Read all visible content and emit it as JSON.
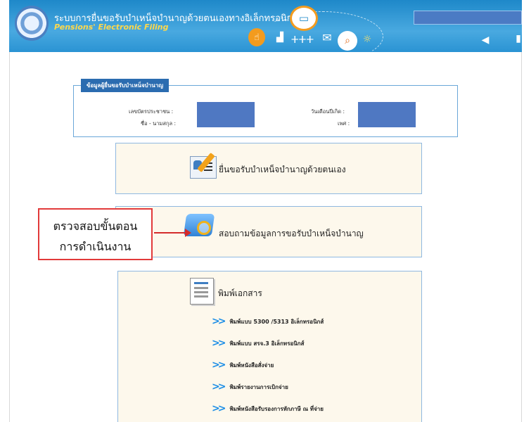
{
  "header": {
    "title": "ระบบการยื่นขอรับบำเหน็จบำนาญด้วยตนเองทางอิเล็กทรอนิกส์",
    "subtitle": "Pensions' Electronic Filing",
    "icons": [
      "emblem-logo-icon",
      "hand-icon",
      "chart-icon",
      "monitor-icon",
      "people-icon",
      "mail-icon",
      "search-icon",
      "lightbulb-icon",
      "speaker-icon",
      "phone-icon"
    ]
  },
  "info": {
    "legend": "ข้อมูลผู้ยื่นขอรับบำเหน็จบำนาญ",
    "id_label": "เลขบัตรประชาชน :",
    "name_label": "ชื่อ - นามสกุล :",
    "dob_label": "วันเดือนปีเกิด :",
    "gender_label": "เพศ :"
  },
  "menu": {
    "file_label": "ยื่นขอรับบำเหน็จบำนาญด้วยตนเอง",
    "inquiry_label": "สอบถามข้อมูลการขอรับบำเหน็จบำนาญ",
    "print_label": "พิมพ์เอกสาร",
    "print_items": [
      "พิมพ์แบบ 5300 /5313 อิเล็กทรอนิกส์",
      "พิมพ์แบบ สรจ.3 อิเล็กทรอนิกส์",
      "พิมพ์หนังสือสั่งจ่าย",
      "พิมพ์รายงานการเบิกจ่าย",
      "พิมพ์หนังสือรับรองการหักภาษี ณ ที่จ่าย"
    ]
  },
  "callout": {
    "line1": "ตรวจสอบขั้นตอน",
    "line2": "การดำเนินงาน"
  },
  "colors": {
    "header_blue": "#2a93d3",
    "accent_orange": "#f39b1e",
    "card_bg": "#fdf8ec",
    "callout_red": "#e23a3a"
  }
}
